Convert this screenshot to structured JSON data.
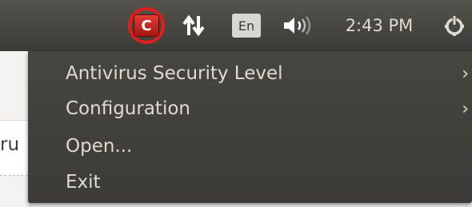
{
  "panel": {
    "app_icon_letter": "C",
    "language": "En",
    "clock": "2:43 PM"
  },
  "background": {
    "partial_text": "ru"
  },
  "menu": {
    "items": [
      {
        "label": "Antivirus Security Level",
        "has_submenu": true
      },
      {
        "label": "Configuration",
        "has_submenu": true
      },
      {
        "label": "Open...",
        "has_submenu": false
      },
      {
        "label": "Exit",
        "has_submenu": false
      }
    ]
  },
  "icons": {
    "app": "comodo-antivirus-icon",
    "network": "network-arrows-icon",
    "volume": "volume-icon",
    "power": "power-icon",
    "submenu": "chevron-right-icon"
  },
  "colors": {
    "panel": "#3c3b37",
    "menu_bg": "#3c3b37",
    "menu_text": "#dfdbd2",
    "highlight_ring": "#e21d1d",
    "app_icon_red": "#d2231c"
  }
}
